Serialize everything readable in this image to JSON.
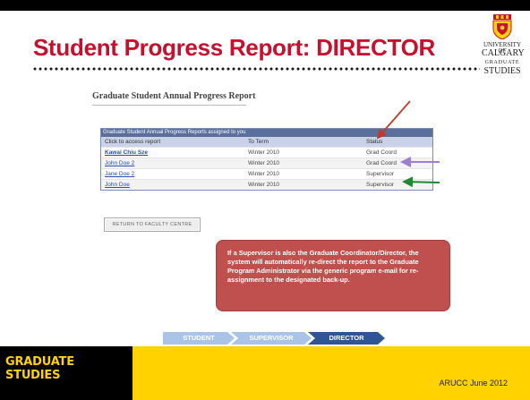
{
  "slide": {
    "title": "Student Progress Report: DIRECTOR"
  },
  "logo": {
    "line1": "UNIVERSITY OF",
    "line2": "CALGARY",
    "line3": "GRADUATE",
    "line4": "STUDIES"
  },
  "report": {
    "title": "Graduate Student Annual Progress Report",
    "table_caption": "Graduate Student Annual Progress Reports assigned to you",
    "columns": [
      "Click to access report",
      "To Term",
      "Status"
    ],
    "rows": [
      {
        "name": "Kawai Chiu Sze",
        "term": "Winter 2010",
        "status": "Grad Coord"
      },
      {
        "name": "John Doe 2",
        "term": "Winter 2010",
        "status": "Grad Coord"
      },
      {
        "name": "Jane Doe 2",
        "term": "Winter 2010",
        "status": "Supervisor"
      },
      {
        "name": "John Doe",
        "term": "Winter 2010",
        "status": "Supervisor"
      }
    ],
    "return_button": "RETURN TO FACULTY CENTRE"
  },
  "callout": {
    "text": "If a Supervisor is also the Graduate Coordinator/Director, the system will automatically re-direct the report to the Graduate Program Administrator via the generic program e-mail for re-assignment to the designated back-up."
  },
  "workflow": {
    "steps": [
      "STUDENT",
      "SUPERVISOR",
      "DIRECTOR"
    ]
  },
  "footer": {
    "brand": "GRADUATE STUDIES",
    "date": "ARUCC June 2012"
  },
  "colors": {
    "title_red": "#c8102e",
    "callout_red": "#c0504d",
    "step_light": "#a9c4e6",
    "step_active": "#2f5597",
    "footer_yellow": "#ffd200",
    "arrow_red": "#c0392b",
    "arrow_purple": "#9b7fd1",
    "arrow_green": "#1e8a2e"
  },
  "icons": {
    "crest": "university-crest-icon"
  }
}
